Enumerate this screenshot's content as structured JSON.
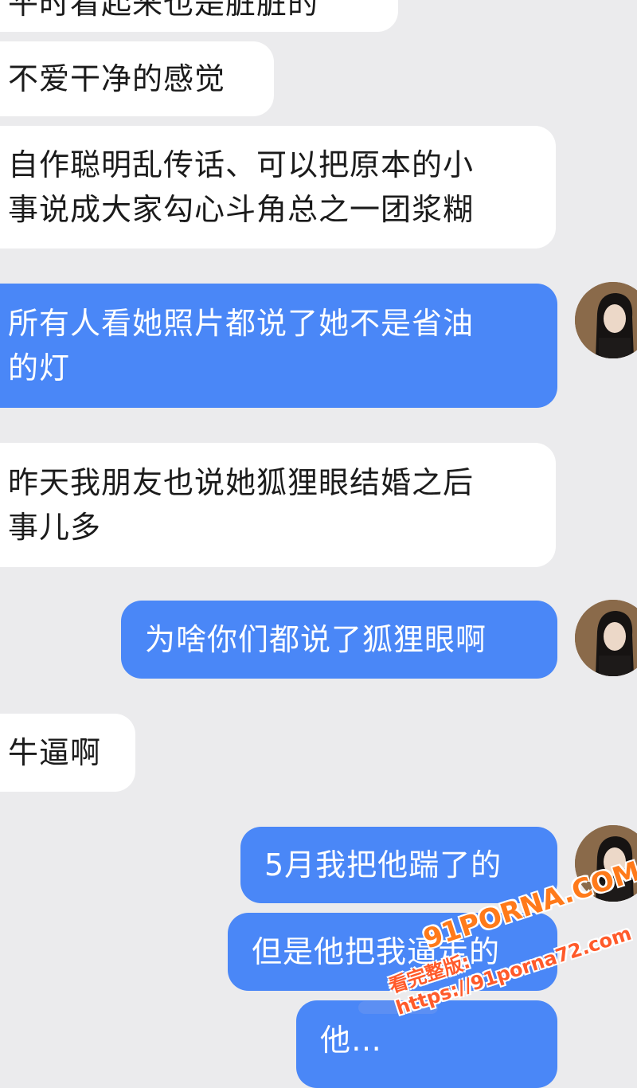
{
  "conversation": {
    "messages": [
      {
        "id": "m0",
        "side": "received",
        "lines": [
          "平时看起来也是脏脏的"
        ]
      },
      {
        "id": "m1",
        "side": "received",
        "lines": [
          "不爱干净的感觉"
        ]
      },
      {
        "id": "m2",
        "side": "received",
        "lines": [
          "自作聪明乱传话、可以把原本的小",
          "事说成大家勾心斗角总之一团浆糊"
        ]
      },
      {
        "id": "m3",
        "side": "sent",
        "lines": [
          "所有人看她照片都说了她不是省油",
          "的灯"
        ]
      },
      {
        "id": "m4",
        "side": "received",
        "lines": [
          "昨天我朋友也说她狐狸眼结婚之后",
          "事儿多"
        ]
      },
      {
        "id": "m5",
        "side": "sent",
        "lines": [
          "为啥你们都说了狐狸眼啊"
        ]
      },
      {
        "id": "m6",
        "side": "received",
        "lines": [
          "牛逼啊"
        ]
      },
      {
        "id": "m7",
        "side": "sent",
        "lines": [
          "5月我把他踹了的"
        ]
      },
      {
        "id": "m8",
        "side": "sent",
        "lines": [
          "但是他把我逼走的"
        ]
      },
      {
        "id": "m9",
        "side": "sent",
        "lines": [
          "他…"
        ]
      }
    ]
  },
  "avatar": {
    "icon": "user-avatar-photo"
  },
  "watermark": {
    "logo": "91PORNA.COM",
    "line": "看完整版: https://91porna72.com"
  },
  "colors": {
    "background": "#ebebed",
    "received_bubble": "#ffffff",
    "sent_bubble": "#4a87f7",
    "watermark": "#ff7a1a"
  }
}
